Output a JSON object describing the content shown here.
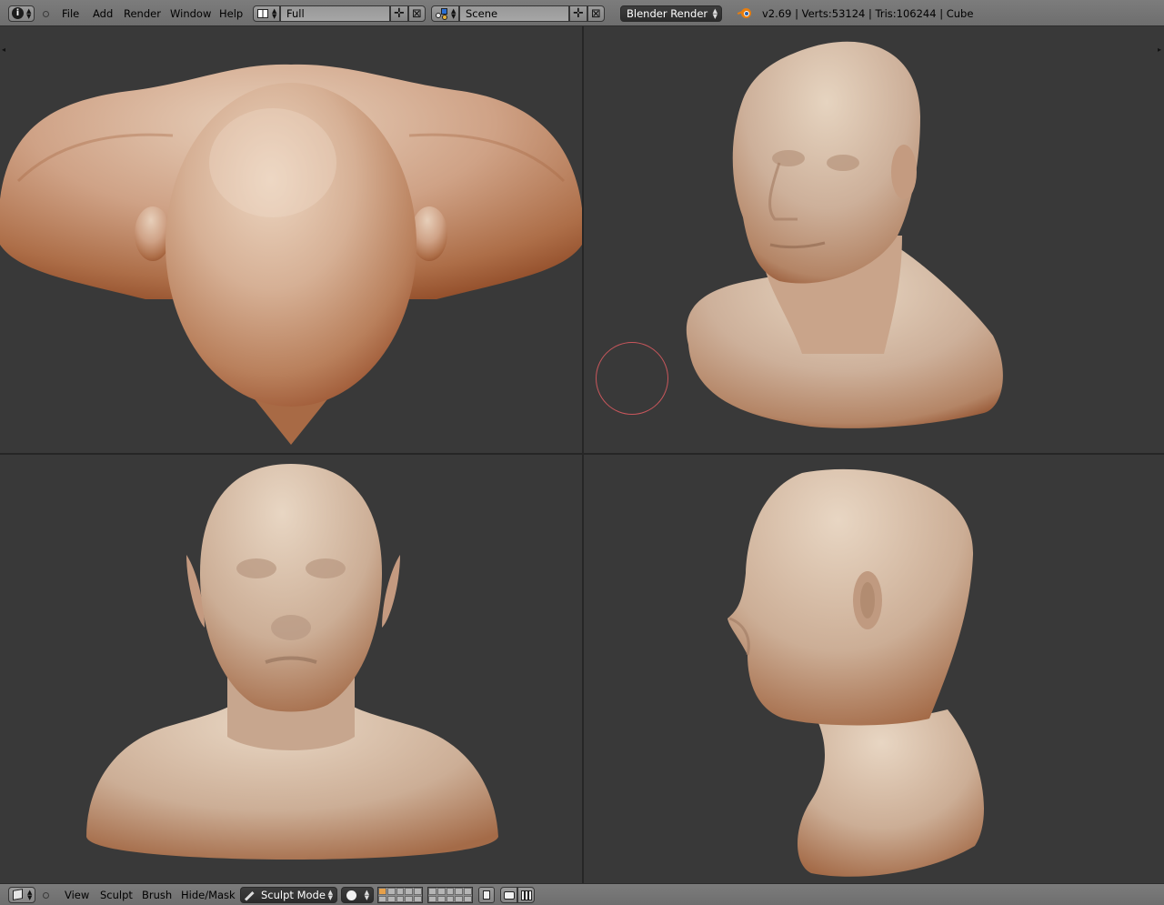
{
  "header": {
    "info_icon": "info-icon",
    "menus": [
      "File",
      "Add",
      "Render",
      "Window",
      "Help"
    ],
    "screen_layout": {
      "icon": "screen-layout-icon",
      "value": "Full"
    },
    "scene": {
      "icon": "scene-icon",
      "value": "Scene"
    },
    "render_engine": "Blender Render",
    "stats": "v2.69 | Verts:53124 | Tris:106244 | Cube"
  },
  "viewports": [
    {
      "name": "top-view"
    },
    {
      "name": "perspective-view"
    },
    {
      "name": "front-view"
    },
    {
      "name": "side-view"
    }
  ],
  "footer": {
    "editor_icon": "view3d-icon",
    "menus": [
      "View",
      "Sculpt",
      "Brush",
      "Hide/Mask"
    ],
    "mode": {
      "icon": "brush-icon",
      "label": "Sculpt Mode"
    },
    "shading_icon": "solid-shading-icon"
  },
  "colors": {
    "background": "#393939",
    "header": "#727272",
    "skin_light": "#e2c8b0",
    "skin_shadow": "#a5643f",
    "brush_circle": "#c9575c"
  }
}
